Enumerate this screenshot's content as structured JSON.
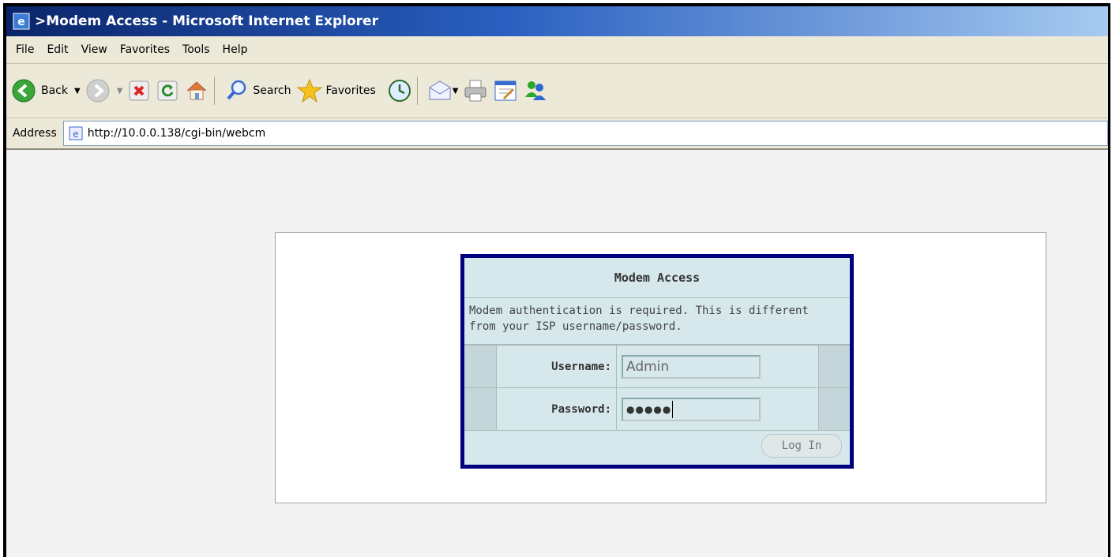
{
  "window": {
    "title": ">Modem Access - Microsoft Internet Explorer"
  },
  "menu": [
    "File",
    "Edit",
    "View",
    "Favorites",
    "Tools",
    "Help"
  ],
  "toolbar": {
    "back_label": "Back",
    "search_label": "Search",
    "favorites_label": "Favorites"
  },
  "address": {
    "label": "Address",
    "url": "http://10.0.0.138/cgi-bin/webcm"
  },
  "dialog": {
    "title": "Modem Access",
    "message_line1": "Modem authentication is required. This is different",
    "message_line2": "from your ISP username/password.",
    "username_label": "Username:",
    "username_value": "Admin",
    "password_label": "Password:",
    "password_value": "●●●●●",
    "login_label": "Log In"
  },
  "colors": {
    "dialog_border": "#000080",
    "dialog_bg": "#d6e8eb",
    "titlebar_start": "#0a246a"
  }
}
